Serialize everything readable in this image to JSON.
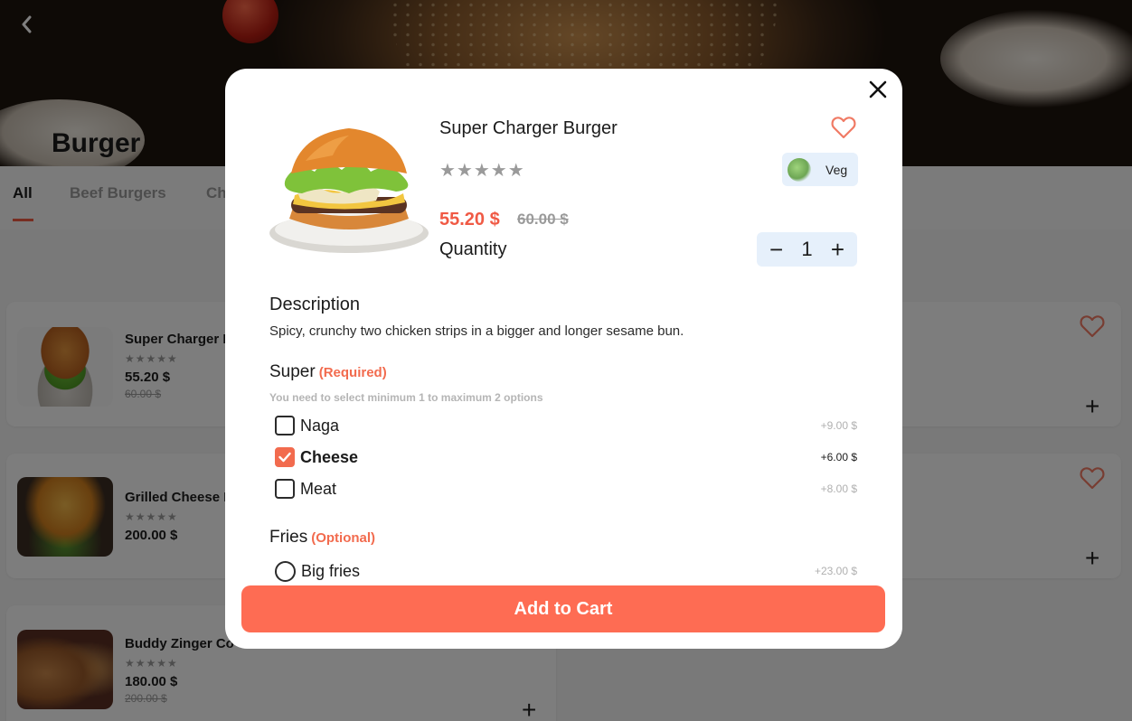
{
  "background": {
    "category_title": "Burger",
    "tabs": [
      {
        "label": "All"
      },
      {
        "label": "Beef Burgers"
      },
      {
        "label": "Ch"
      }
    ],
    "cards": [
      {
        "name": "Super Charger I",
        "stars": "★★★★★",
        "price": "55.20 $",
        "old_price": "60.00 $"
      },
      {
        "name": "Grilled Cheese I",
        "stars": "★★★★★",
        "price": "200.00 $",
        "old_price": ""
      },
      {
        "name": "Buddy Zinger Co",
        "stars": "★★★★★",
        "price": "180.00 $",
        "old_price": "200.00 $"
      }
    ]
  },
  "modal": {
    "product_name": "Super Charger Burger",
    "rating": "★★★★★",
    "veg_label": "Veg",
    "price": "55.20 $",
    "old_price": "60.00 $",
    "quantity_label": "Quantity",
    "quantity": "1",
    "minus": "−",
    "plus": "+",
    "description_title": "Description",
    "description": "Spicy, crunchy two chicken strips in a bigger and longer sesame bun.",
    "groups": [
      {
        "title": "Super",
        "tag": "(Required)",
        "hint": "You need to select minimum 1 to maximum 2 options",
        "options": [
          {
            "label": "Naga",
            "price": "+9.00 $",
            "checked": false
          },
          {
            "label": "Cheese",
            "price": "+6.00 $",
            "checked": true
          },
          {
            "label": "Meat",
            "price": "+8.00 $",
            "checked": false
          }
        ]
      },
      {
        "title": "Fries",
        "tag": "(Optional)",
        "options": [
          {
            "label": "Big fries",
            "price": "+23.00 $",
            "checked": false
          }
        ]
      }
    ],
    "add_to_cart": "Add to Cart"
  },
  "colors": {
    "accent": "#fe6c53",
    "price_red": "#f05a45",
    "badge_bg": "#e6f0fb"
  }
}
